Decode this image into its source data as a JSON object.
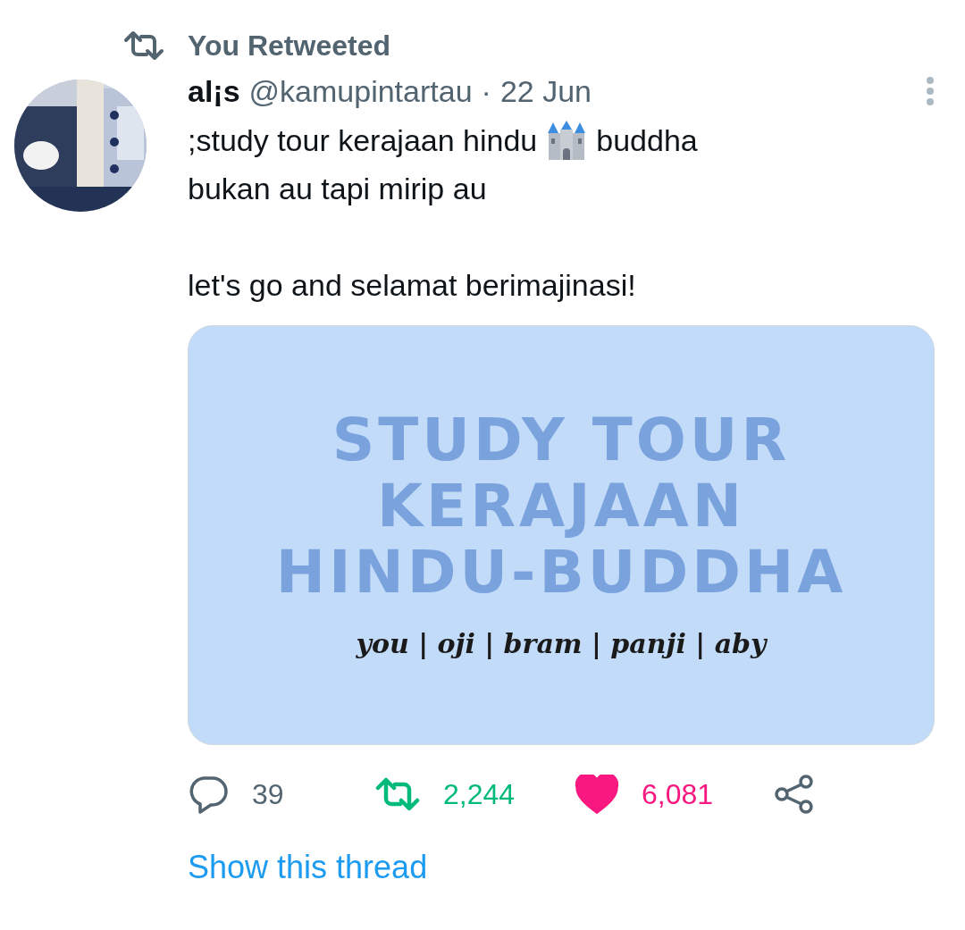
{
  "social_context": {
    "label": "You Retweeted"
  },
  "tweet": {
    "display_name": "al¡s",
    "handle": "@kamupintartau",
    "separator": "·",
    "date": "22 Jun",
    "text_before_emoji": ";study tour kerajaan hindu",
    "text_after_emoji": "buddha",
    "paragraphs": [
      [
        "bukan au tapi mirip au"
      ],
      [
        "let's go and selamat berimajinasi!"
      ]
    ],
    "media": {
      "title_lines": [
        "STUDY TOUR",
        "KERAJAAN",
        "HINDU-BUDDHA"
      ],
      "caption": "you | oji | bram | panji | aby"
    },
    "actions": [
      {
        "kind": "reply",
        "count": "39",
        "active": false
      },
      {
        "kind": "retweet",
        "count": "2,244",
        "active": true
      },
      {
        "kind": "like",
        "count": "6,081",
        "active": true
      },
      {
        "kind": "share"
      }
    ],
    "thread_link": "Show this thread"
  }
}
